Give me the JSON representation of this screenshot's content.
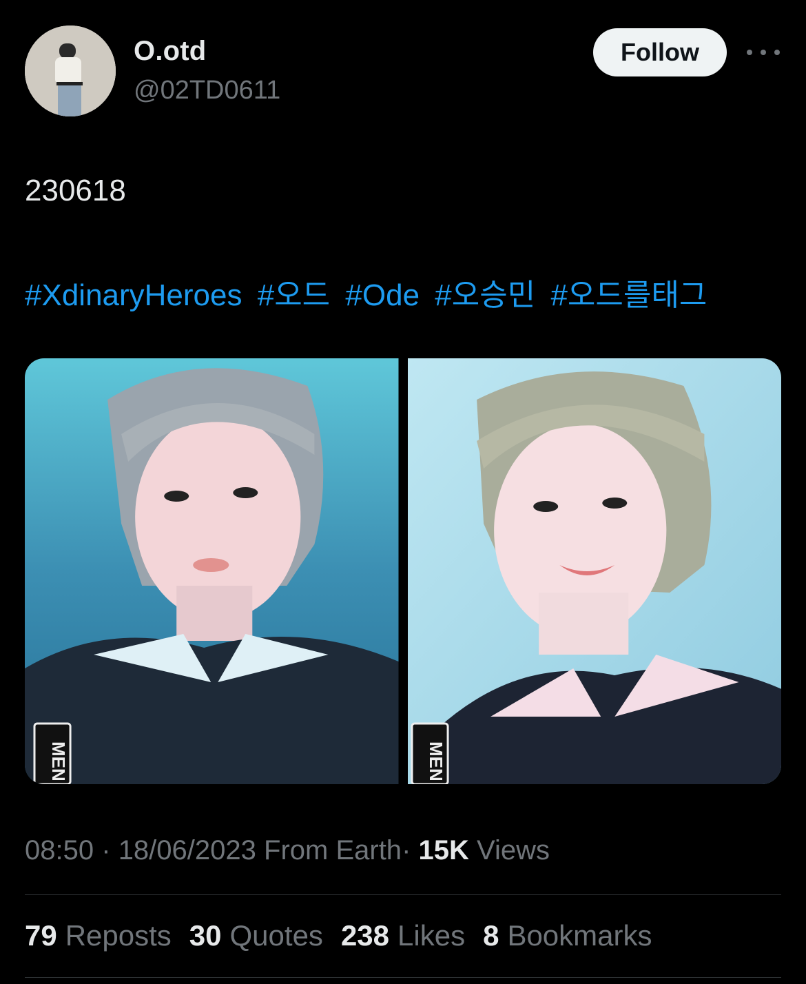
{
  "author": {
    "display_name": "O.otd",
    "handle": "@02TD0611"
  },
  "actions": {
    "follow_label": "Follow",
    "more_icon": "more-horizontal-icon"
  },
  "tweet": {
    "text": "230618",
    "hashtags": [
      "#XdinaryHeroes",
      "#오드",
      "#Ode",
      "#오승민",
      "#오드를태그"
    ],
    "media": [
      {
        "overlay_text": "MEN"
      },
      {
        "overlay_text": "MEN"
      }
    ]
  },
  "meta": {
    "time": "08:50",
    "separator": "·",
    "date": "18/06/2023",
    "source": "From Earth",
    "views_count": "15K",
    "views_label": "Views"
  },
  "stats": [
    {
      "count": "79",
      "label": "Reposts"
    },
    {
      "count": "30",
      "label": "Quotes"
    },
    {
      "count": "238",
      "label": "Likes"
    },
    {
      "count": "8",
      "label": "Bookmarks"
    }
  ],
  "colors": {
    "background": "#000000",
    "text": "#e7e9ea",
    "muted": "#71767b",
    "link": "#1d9bf0",
    "follow_bg": "#eff3f4"
  }
}
